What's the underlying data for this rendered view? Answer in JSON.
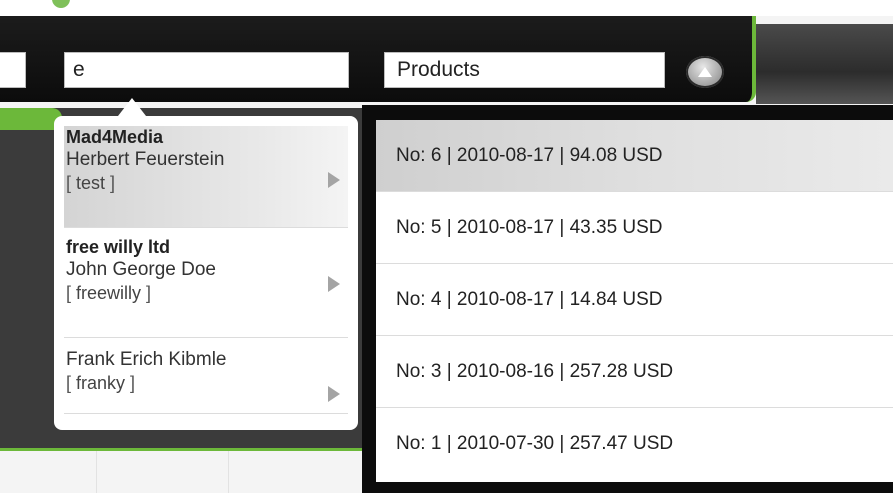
{
  "toolbar": {
    "search_value": "e",
    "type_select_value": "Products"
  },
  "customer_suggestions": [
    {
      "company": "Mad4Media",
      "name": "Herbert Feuerstein",
      "username": "test",
      "active": true
    },
    {
      "company": "free willy ltd",
      "name": "John George Doe",
      "username": "freewilly",
      "active": false
    },
    {
      "company": "",
      "name": "Frank Erich Kibmle",
      "username": "franky",
      "active": false
    }
  ],
  "product_results": [
    {
      "label": "No: 6 | 2010-08-17 | 94.08 USD",
      "active": true
    },
    {
      "label": "No: 5 | 2010-08-17 | 43.35 USD",
      "active": false
    },
    {
      "label": "No: 4 | 2010-08-17 | 14.84 USD",
      "active": false
    },
    {
      "label": "No: 3 | 2010-08-16 | 257.28 USD",
      "active": false
    },
    {
      "label": "No: 1 | 2010-07-30 | 257.47 USD",
      "active": false
    }
  ],
  "icons": {
    "collapse": "chevron-up-icon",
    "item_arrow": "chevron-right-icon"
  },
  "colors": {
    "accent_green": "#6cb83a",
    "toolbar_dark": "#111111"
  }
}
